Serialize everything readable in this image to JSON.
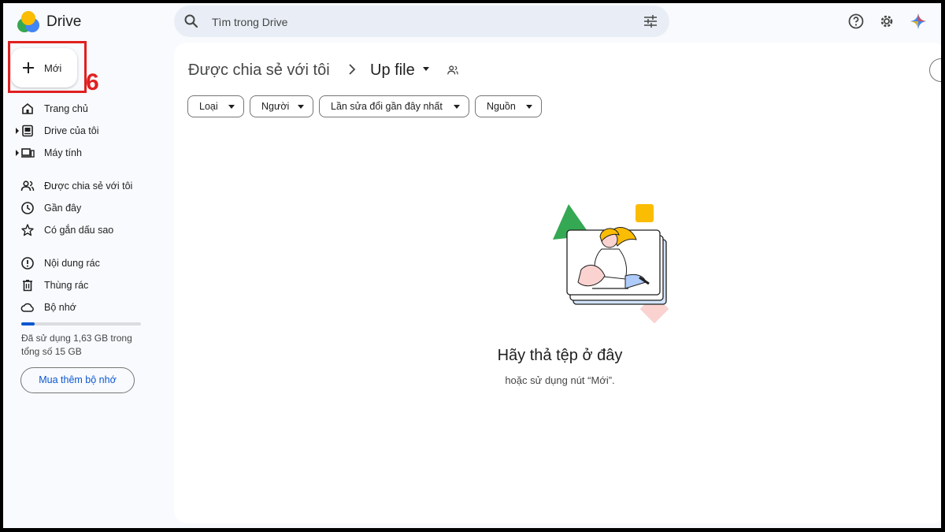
{
  "app": {
    "title": "Drive"
  },
  "search": {
    "placeholder": "Tìm trong Drive"
  },
  "sidebar": {
    "new_label": "Mới",
    "annotation_step": "6",
    "items": [
      {
        "label": "Trang chủ",
        "icon": "home-icon"
      },
      {
        "label": "Drive của tôi",
        "icon": "my-drive-icon"
      },
      {
        "label": "Máy tính",
        "icon": "computer-icon"
      },
      {
        "label": "Được chia sẻ với tôi",
        "icon": "shared-icon"
      },
      {
        "label": "Gần đây",
        "icon": "clock-icon"
      },
      {
        "label": "Có gắn dấu sao",
        "icon": "star-icon"
      },
      {
        "label": "Nội dung rác",
        "icon": "spam-icon"
      },
      {
        "label": "Thùng rác",
        "icon": "trash-icon"
      },
      {
        "label": "Bộ nhớ",
        "icon": "cloud-icon"
      }
    ],
    "storage": {
      "used_fraction": 0.109,
      "text": "Đã sử dụng 1,63 GB trong tổng số 15 GB"
    },
    "buy_label": "Mua thêm bộ nhớ"
  },
  "breadcrumb": {
    "parent": "Được chia sẻ với tôi",
    "current": "Up file"
  },
  "filters": [
    {
      "label": "Loại"
    },
    {
      "label": "Người"
    },
    {
      "label": "Lần sửa đổi gần đây nhất"
    },
    {
      "label": "Nguồn"
    }
  ],
  "empty_state": {
    "title": "Hãy thả tệp ở đây",
    "subtitle": "hoặc sử dụng nút “Mới”."
  },
  "colors": {
    "accent": "#0b57d0",
    "annotation": "#e02020",
    "background": "#f8fafd"
  }
}
